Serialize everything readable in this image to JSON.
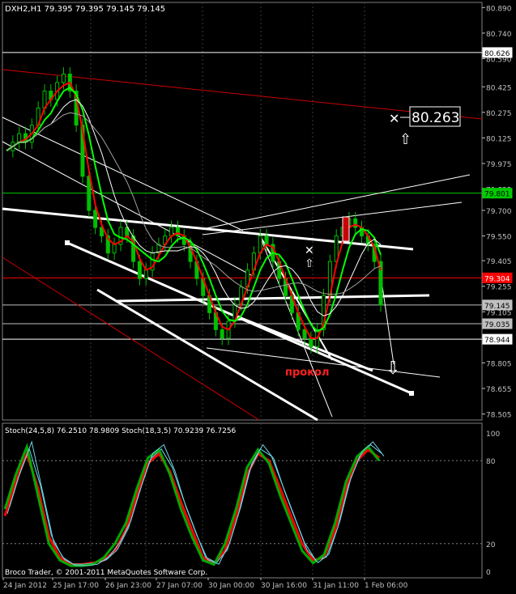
{
  "header": {
    "main_info": "DXH2,H1  79.395 79.395 79.145 79.145",
    "osc_info": "Stoch(24,5,8) 76.2510 78.9809  Stoch(18,3,5) 70.9239 76.7256"
  },
  "footer": {
    "copyright": "Broco Trader, © 2001-2011 MetaQuotes Software Corp."
  },
  "price_axis": {
    "ticks": [
      "80.890",
      "80.740",
      "80.590",
      "80.425",
      "80.275",
      "80.125",
      "79.975",
      "79.825",
      "79.700",
      "79.550",
      "79.405",
      "79.255",
      "79.105",
      "78.955",
      "78.805",
      "78.655",
      "78.505"
    ],
    "markers": [
      {
        "label": "80.626",
        "bg": "#ffffff",
        "fg": "#000000",
        "border": "#ffffff"
      },
      {
        "label": "79.801",
        "bg": "#00cc00",
        "fg": "#000000",
        "border": "#00cc00"
      },
      {
        "label": "79.304",
        "bg": "#ff0000",
        "fg": "#ffffff",
        "border": "#ff0000"
      },
      {
        "label": "79.145",
        "bg": "#c0c0c0",
        "fg": "#000000",
        "border": "#c0c0c0"
      },
      {
        "label": "79.035",
        "bg": "#c0c0c0",
        "fg": "#000000",
        "border": "#c0c0c0"
      },
      {
        "label": "78.944",
        "bg": "#ffffff",
        "fg": "#000000",
        "border": "#ffffff"
      }
    ]
  },
  "osc_axis": {
    "ticks": [
      "100",
      "80",
      "20",
      "0"
    ]
  },
  "time_axis": {
    "ticks": [
      "24 Jan 2012",
      "25 Jan 17:00",
      "26 Jan 23:00",
      "27 Jan 07:00",
      "30 Jan 00:00",
      "30 Jan 16:00",
      "31 Jan 11:00",
      "1 Feb 06:00"
    ]
  },
  "annotations": {
    "target_price": "80.263",
    "pierce_label": "прокол"
  },
  "chart_data": {
    "type": "line",
    "symbol": "DXH2",
    "timeframe": "H1",
    "ohlc_last": {
      "open": 79.395,
      "high": 79.395,
      "low": 79.145,
      "close": 79.145
    },
    "price_range": [
      78.47,
      80.92
    ],
    "oscillator_range": [
      0,
      100
    ],
    "oscillator_levels": [
      80,
      20
    ],
    "price_ticks": [
      80.89,
      80.74,
      80.59,
      80.425,
      80.275,
      80.125,
      79.975,
      79.825,
      79.7,
      79.55,
      79.405,
      79.255,
      79.105,
      78.955,
      78.805,
      78.655,
      78.505
    ],
    "horizontal_levels": [
      {
        "value": 80.626,
        "color": "#ffffff"
      },
      {
        "value": 79.801,
        "color": "#00cc00"
      },
      {
        "value": 79.304,
        "color": "#ff0000"
      },
      {
        "value": 79.145,
        "color": "#c0c0c0"
      },
      {
        "value": 79.035,
        "color": "#c0c0c0"
      },
      {
        "value": 78.944,
        "color": "#ffffff"
      }
    ],
    "close_series": [
      80.05,
      80.1,
      80.15,
      80.1,
      80.2,
      80.3,
      80.4,
      80.35,
      80.45,
      80.5,
      80.4,
      80.2,
      79.9,
      79.7,
      79.6,
      79.55,
      79.45,
      79.5,
      79.6,
      79.55,
      79.4,
      79.3,
      79.35,
      79.45,
      79.5,
      79.55,
      79.6,
      79.55,
      79.5,
      79.4,
      79.3,
      79.2,
      79.1,
      79.0,
      78.95,
      79.05,
      79.15,
      79.25,
      79.35,
      79.45,
      79.55,
      79.5,
      79.4,
      79.3,
      79.2,
      79.1,
      79.0,
      78.95,
      78.9,
      79.0,
      79.2,
      79.4,
      79.55,
      79.6,
      79.65,
      79.6,
      79.55,
      79.5,
      79.4,
      79.145
    ],
    "stochastic": [
      {
        "name": "Stoch(24,5,8)",
        "values": [
          40,
          65,
          85,
          60,
          25,
          10,
          5,
          5,
          6,
          8,
          15,
          30,
          55,
          78,
          85,
          72,
          50,
          30,
          10,
          6,
          15,
          40,
          70,
          85,
          80,
          60,
          40,
          20,
          8,
          10,
          30,
          60,
          80,
          88,
          82
        ],
        "color": "#ff0000"
      },
      {
        "name": "Stoch(18,3,5)",
        "values": [
          45,
          70,
          90,
          55,
          20,
          8,
          4,
          4,
          5,
          10,
          20,
          35,
          60,
          82,
          88,
          70,
          45,
          25,
          8,
          5,
          20,
          45,
          75,
          88,
          78,
          55,
          35,
          15,
          6,
          12,
          35,
          65,
          83,
          90,
          80
        ],
        "color": "#00aa00"
      }
    ]
  }
}
